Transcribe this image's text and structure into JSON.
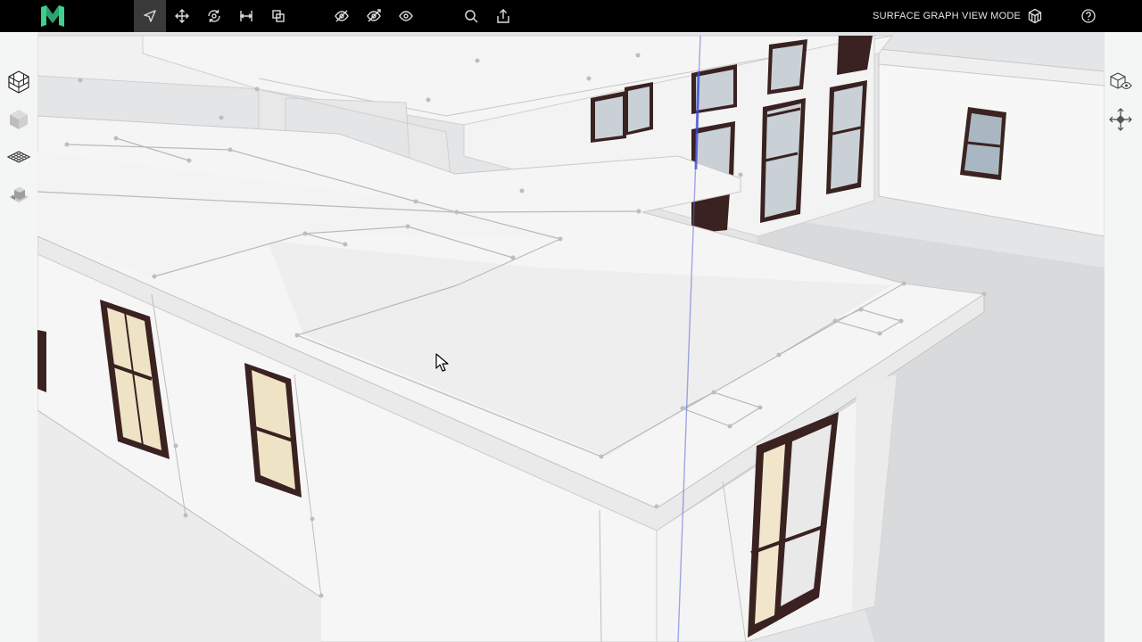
{
  "app": {
    "logo_icon": "app-logo-m-icon",
    "brand_color": "#3fcf8e"
  },
  "toolbar": {
    "tools": [
      {
        "name": "select-tool",
        "icon": "cursor-arrow-icon",
        "active": true
      },
      {
        "name": "move-tool",
        "icon": "move-arrows-icon",
        "active": false
      },
      {
        "name": "orbit-tool",
        "icon": "orbit-icon",
        "active": false
      },
      {
        "name": "measure-tool",
        "icon": "measure-icon",
        "active": false
      },
      {
        "name": "section-tool",
        "icon": "section-box-icon",
        "active": false
      },
      {
        "name": "hide-tool",
        "icon": "eye-slash-icon",
        "active": false
      },
      {
        "name": "isolate-tool",
        "icon": "eye-slash-alt-icon",
        "active": false
      },
      {
        "name": "show-all-tool",
        "icon": "eye-icon",
        "active": false
      },
      {
        "name": "search-tool",
        "icon": "search-icon",
        "active": false
      },
      {
        "name": "share-tool",
        "icon": "share-icon",
        "active": false
      }
    ],
    "mode_label": "SURFACE GRAPH VIEW MODE",
    "mode_icon": "cube-wireframe-icon",
    "help_icon": "help-circle-icon"
  },
  "left_rail": [
    {
      "name": "view-mesh",
      "icon": "cube-wireframe-icon"
    },
    {
      "name": "view-solid",
      "icon": "cube-solid-icon"
    },
    {
      "name": "view-floorplan",
      "icon": "grid-plane-icon"
    },
    {
      "name": "view-dollhouse",
      "icon": "dollhouse-icon"
    }
  ],
  "right_rail": [
    {
      "name": "visibility-toggle",
      "icon": "cube-eye-icon"
    },
    {
      "name": "recenter",
      "icon": "crosshair-arrows-icon"
    }
  ]
}
